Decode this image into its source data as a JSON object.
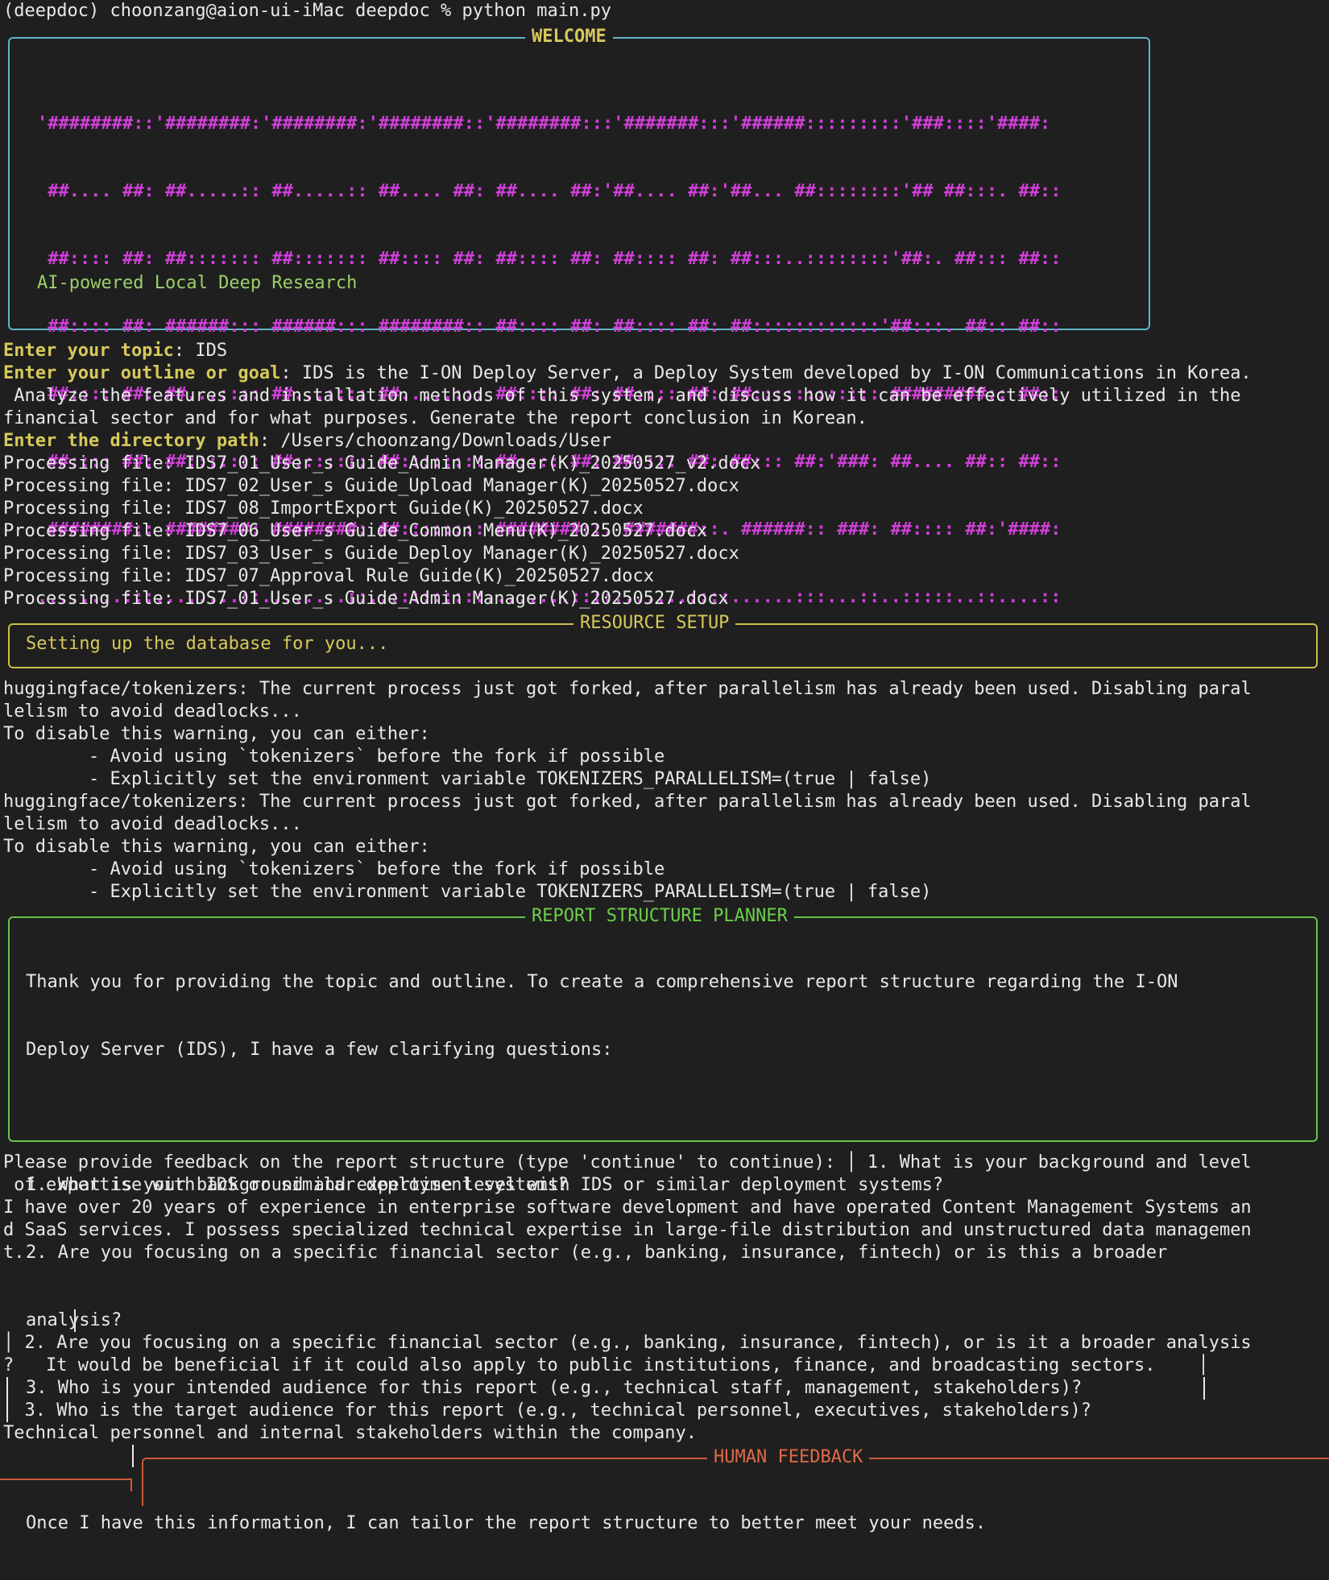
{
  "terminal": {
    "command_line": "(deepdoc) choonzang@aion-ui-iMac deepdoc % python main.py"
  },
  "welcome": {
    "title": "WELCOME",
    "banner_lines": [
      "'########::'########:'########:'########::'########:::'#######:::'######:::::::::'###::::'####:",
      " ##.... ##: ##.....:: ##.....:: ##.... ##: ##.... ##:'##.... ##:'##... ##::::::::'## ##:::. ##::",
      " ##:::: ##: ##::::::: ##::::::: ##:::: ##: ##:::: ##: ##:::: ##: ##:::..::::::::'##:. ##::: ##::",
      " ##:::: ##: ######::: ######::: ########:: ##:::: ##: ##:::: ##: ##::::::::::::'##:::. ##:: ##::",
      " ##:::: ##: ##...:::: ##...:::: ##.....::: ##:::: ##: ##:::: ##: ##:::::::::::: #########:: ##::",
      " ##:::: ##: ##::::::: ##::::::: ##:::::::: ##:::: ##: ##:::: ##: ##::: ##:'###: ##.... ##:: ##::",
      " ########:: ########: ########: ##:::::::: ########::. #######::. ######:: ###: ##:::: ##:'####:",
      "........:::........::........::..:::::::::........::::.......::::......:::...::..:::::..::....::"
    ],
    "subtitle": "AI-powered Local Deep Research"
  },
  "inputs": {
    "topic_label": "Enter your topic",
    "topic_value": ": IDS",
    "outline_label": "Enter your outline or goal",
    "outline_value_1": ": IDS is the I-ON Deploy Server, a Deploy System developed by I-ON Communications in Korea.",
    "outline_value_2": " Analyze the features and installation methods of this system, and discuss how it can be effectively utilized in the",
    "outline_value_3": "financial sector and for what purposes. Generate the report conclusion in Korean.",
    "dir_label": "Enter the directory path",
    "dir_value": ": /Users/choonzang/Downloads/User"
  },
  "processing": [
    "Processing file: IDS7_01_User_s Guide_Admin Manager(K)_20250527_v2.docx",
    "Processing file: IDS7_02_User_s Guide_Upload Manager(K)_20250527.docx",
    "Processing file: IDS7_08_ImportExport Guide(K)_20250527.docx",
    "Processing file: IDS7_06_User_s Guide_Common Menu(K)_20250527.docx",
    "Processing file: IDS7_03_User_s Guide_Deploy Manager(K)_20250527.docx",
    "Processing file: IDS7_07_Approval Rule Guide(K)_20250527.docx",
    "Processing file: IDS7_01_User_s Guide_Admin Manager(K)_20250527.docx"
  ],
  "resource": {
    "title": "RESOURCE SETUP",
    "message": "Setting up the database for you..."
  },
  "warnings": [
    "huggingface/tokenizers: The current process just got forked, after parallelism has already been used. Disabling paral",
    "lelism to avoid deadlocks...",
    "To disable this warning, you can either:",
    "        - Avoid using `tokenizers` before the fork if possible",
    "        - Explicitly set the environment variable TOKENIZERS_PARALLELISM=(true | false)",
    "huggingface/tokenizers: The current process just got forked, after parallelism has already been used. Disabling paral",
    "lelism to avoid deadlocks...",
    "To disable this warning, you can either:",
    "        - Avoid using `tokenizers` before the fork if possible",
    "        - Explicitly set the environment variable TOKENIZERS_PARALLELISM=(true | false)"
  ],
  "planner": {
    "title": "REPORT STRUCTURE PLANNER",
    "lines": [
      "Thank you for providing the topic and outline. To create a comprehensive report structure regarding the I-ON",
      "Deploy Server (IDS), I have a few clarifying questions:",
      "",
      "1. What is your background and expertise level with IDS or similar deployment systems?",
      "2. Are you focusing on a specific financial sector (e.g., banking, insurance, fintech) or is this a broader",
      "analysis?",
      "3. Who is your intended audience for this report (e.g., technical staff, management, stakeholders)?",
      "",
      "Once I have this information, I can tailor the report structure to better meet your needs."
    ]
  },
  "feedback": {
    "lines": [
      "Please provide feedback on the report structure (type 'continue' to continue): │ 1. What is your background and level",
      " of expertise with IDS or similar deployment systems?",
      "I have over 20 years of experience in enterprise software development and have operated Content Management Systems an",
      "d SaaS services. I possess specialized technical expertise in large-file distribution and unstructured data managemen",
      "t."
    ],
    "q2_line1": "│ 2. Are you focusing on a specific financial sector (e.g., banking, insurance, fintech), or is it a broader analysis",
    "q2_line2": "?   It would be beneficial if it could also apply to public institutions, finance, and broadcasting sectors.    │",
    "q3_line1": "  3. Who is the target audience for this report (e.g., technical personnel, executives, stakeholders)?",
    "q3_line2": "Technical personnel and internal stakeholders within the company.",
    "human_title": "HUMAN FEEDBACK"
  }
}
